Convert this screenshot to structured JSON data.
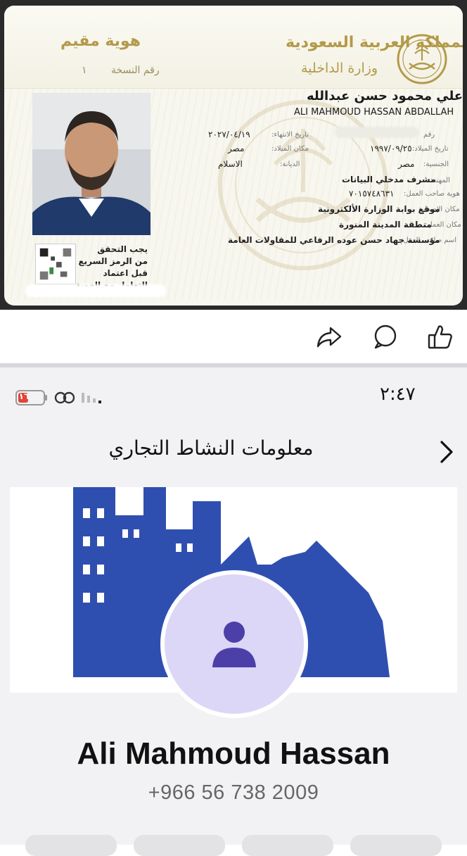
{
  "id_card": {
    "card_type": "هوية مقيم",
    "ministry_line1": "المملكة العربية السعودية",
    "ministry_line2": "وزارة الداخلية",
    "version_label": "رقم النسخة",
    "version_value": "١",
    "name_ar": "علي محمود حسن عبدالله",
    "name_en": "ALI MAHMOUD HASSAN ABDALLAH",
    "fields": {
      "id_number_label": "رقم",
      "expiry_label": "تاريخ الانتهاء:",
      "expiry_value": "٢٠٢٧/٠٤/١٩",
      "dob_label": "تاريخ الميلاد:",
      "dob_value": "١٩٩٧/٠٩/٢٥",
      "birthplace_label": "مكان الميلاد:",
      "birthplace_value": "مصر",
      "nationality_label": "الجنسية:",
      "nationality_value": "مصر",
      "religion_label": "الديانة:",
      "religion_value": "الاسلام",
      "profession_label": "المهنة:",
      "profession_value": "مشرف مدخلي البيانات",
      "employer_id_label": "هوية صاحب العمل:",
      "employer_id_value": "٧٠١٥٧٤٨٦٣١",
      "issue_place_label": "مكان الإصدار:",
      "issue_place_value": "موقع بوابة الوزارة الألكترونية",
      "work_place_label": "مكان العمل:",
      "work_place_value": "منطقة المدينة المنورة",
      "employer_name_label": "اسم صاحب العمل:",
      "employer_name_value": "مؤسسة جهاد حسن عوده الرفاعي للمقاولات العامة"
    },
    "qr_notice": [
      "يجب التحقق",
      "من الرمز السريع",
      "قبل اعتماد",
      "التعامل مع الهوية"
    ]
  },
  "post_actions": {
    "share_icon": "share-icon",
    "comment_icon": "comment-icon",
    "like_icon": "thumbs-up-icon"
  },
  "phone": {
    "status_time": "٢:٤٧",
    "battery_text": "١٦",
    "nav_title": "معلومات النشاط التجاري",
    "profile_name": "Ali Mahmoud Hassan",
    "profile_phone": "+966 56 738 2009"
  },
  "colors": {
    "gold": "#b39a4a",
    "cover_blue": "#2f4fb0",
    "avatar_bg": "#dcd6f7",
    "avatar_fg": "#4c3fa8",
    "battery_red": "#e0443a"
  }
}
